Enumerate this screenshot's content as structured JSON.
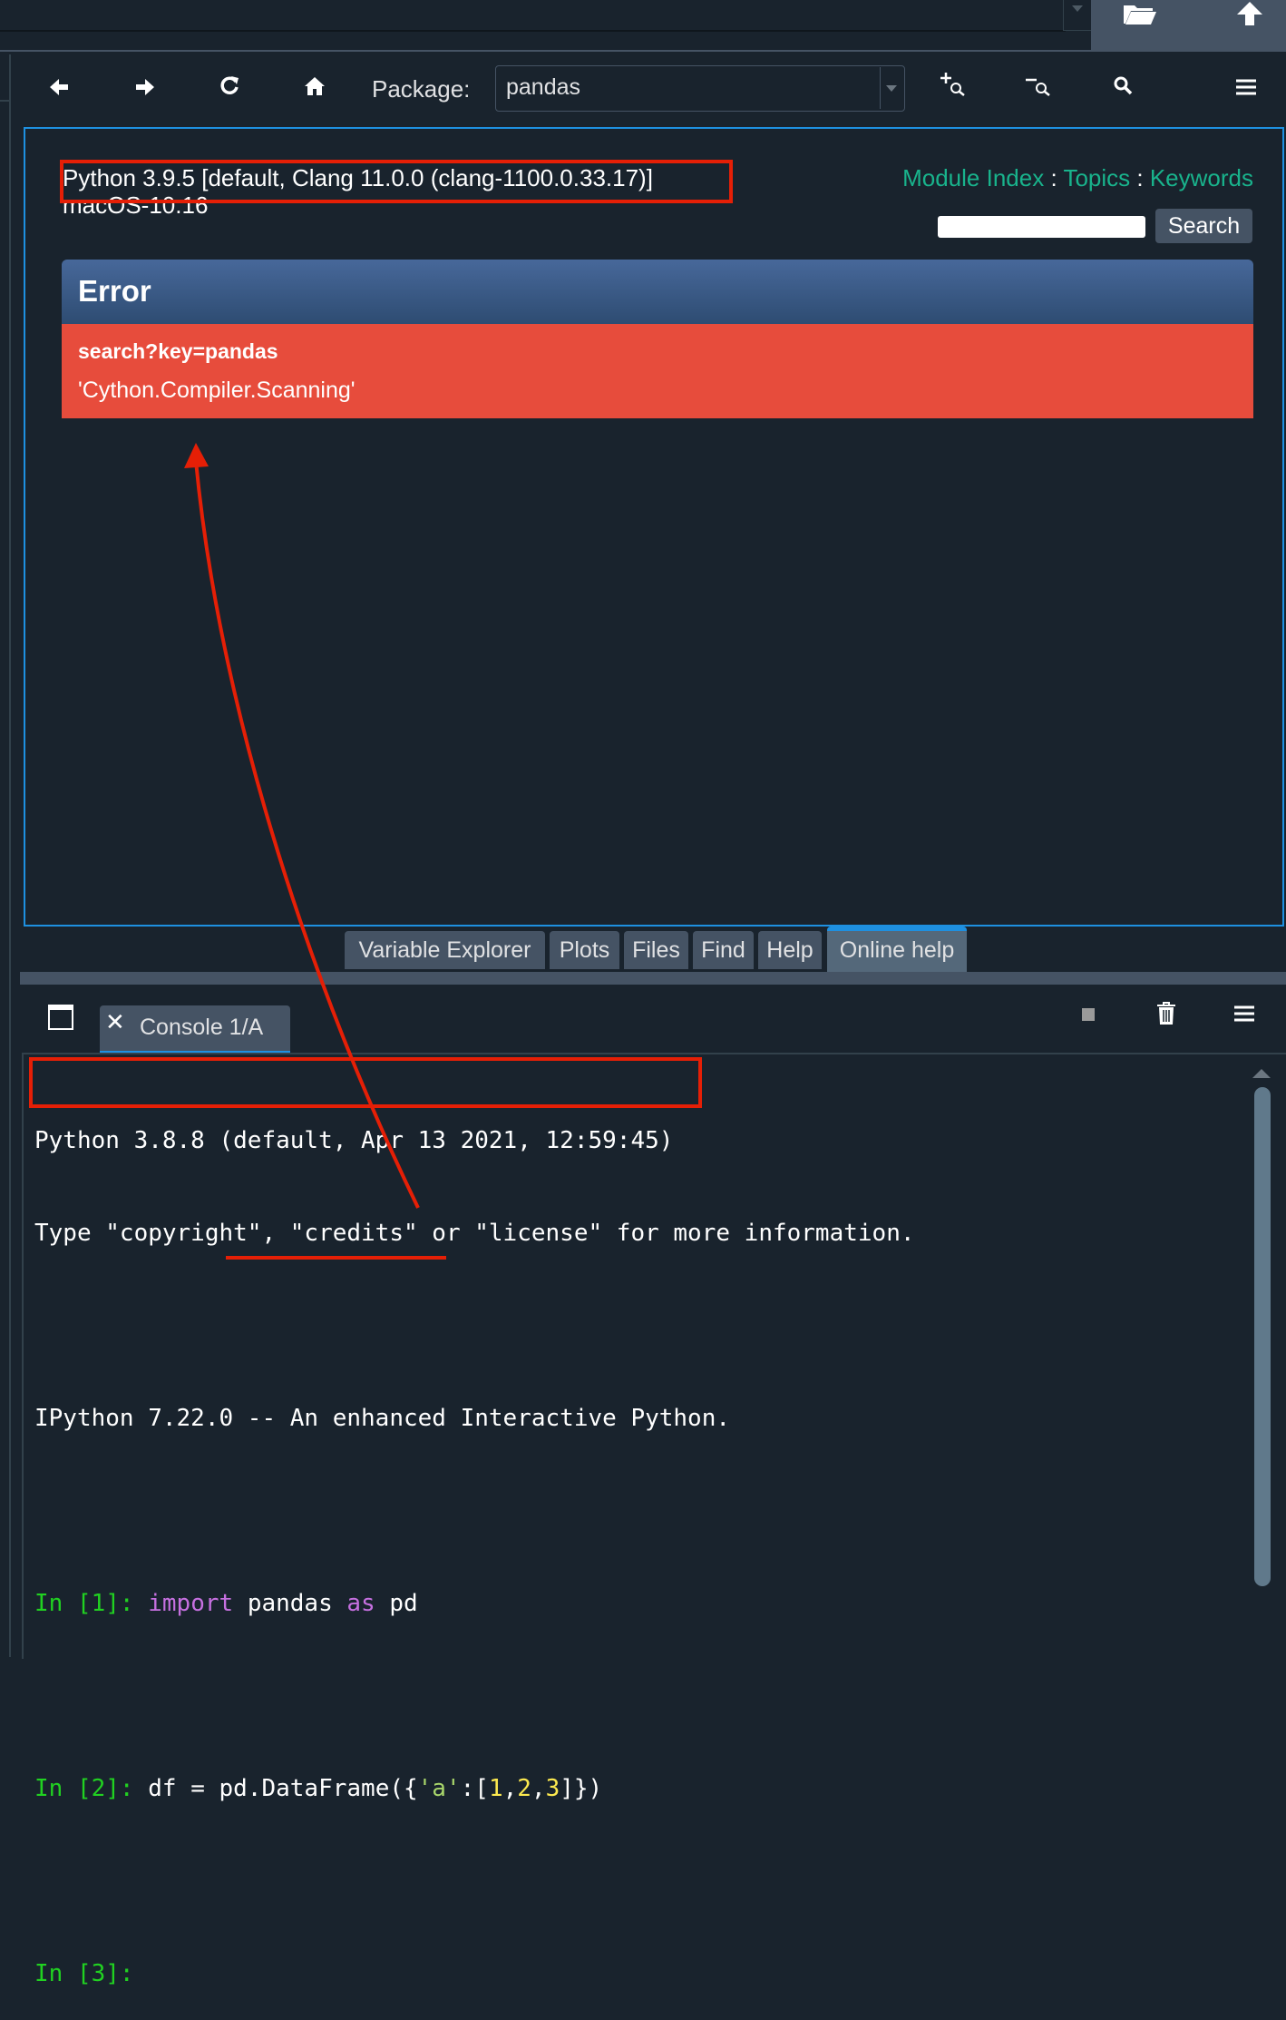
{
  "help_pane": {
    "package_label": "Package:",
    "package_value": "pandas",
    "python_info_line1": "Python 3.9.5 [default, Clang 11.0.0 (clang-1100.0.33.17)]",
    "python_info_line2": "macOS-10.16",
    "links": {
      "module_index": "Module Index",
      "separator": ":",
      "topics": "Topics",
      "keywords": "Keywords"
    },
    "search_button": "Search",
    "error": {
      "title": "Error",
      "key": "search?key=pandas",
      "message": "'Cython.Compiler.Scanning'"
    }
  },
  "tabs": {
    "variable_explorer": "Variable Explorer",
    "plots": "Plots",
    "files": "Files",
    "find": "Find",
    "help": "Help",
    "online_help": "Online help"
  },
  "console": {
    "tab_label": "Console 1/A",
    "lines": {
      "banner1": "Python 3.8.8 (default, Apr 13 2021, 12:59:45)",
      "banner2": "Type \"copyright\", \"credits\" or \"license\" for more information.",
      "banner3": "IPython 7.22.0 -- An enhanced Interactive Python.",
      "in1_prompt": "In [1]:",
      "in1_kw1": "import",
      "in1_mod": "pandas",
      "in1_kw2": "as",
      "in1_alias": "pd",
      "in2_prompt": "In [2]:",
      "in2_code_a": "df = pd.DataFrame({",
      "in2_str": "'a'",
      "in2_code_b": ":[",
      "in2_n1": "1",
      "in2_n2": "2",
      "in2_n3": "3",
      "in2_code_c": "]})",
      "in2_comma": ",",
      "in3_prompt": "In [3]:"
    }
  },
  "colors": {
    "annotation_red": "#e51f06",
    "accent_blue": "#1e90e0",
    "link_green": "#19b38c",
    "error_red": "#e74c3c"
  },
  "icons": [
    "back-arrow-icon",
    "forward-arrow-icon",
    "reload-icon",
    "home-icon",
    "zoom-in-icon",
    "zoom-out-icon",
    "find-icon",
    "menu-icon",
    "folder-open-icon",
    "upload-icon",
    "window-icon",
    "close-icon",
    "stop-icon",
    "trash-icon"
  ]
}
